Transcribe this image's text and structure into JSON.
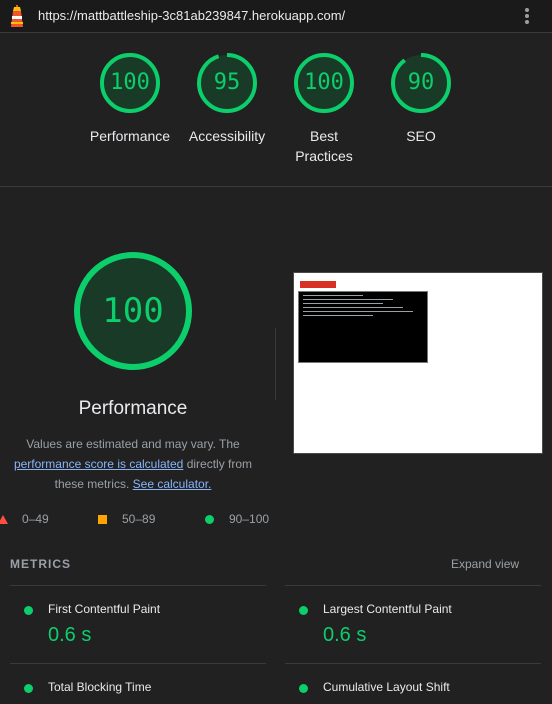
{
  "topbar": {
    "url": "https://mattbattleship-3c81ab239847.herokuapp.com/",
    "logo_icon": "lighthouse-icon",
    "menu_icon": "more-vertical-icon"
  },
  "summary": [
    {
      "score": "100",
      "label_line1": "Performance",
      "label_line2": ""
    },
    {
      "score": "95",
      "label_line1": "Accessibility",
      "label_line2": ""
    },
    {
      "score": "100",
      "label_line1": "Best",
      "label_line2": "Practices"
    },
    {
      "score": "90",
      "label_line1": "SEO",
      "label_line2": ""
    }
  ],
  "gauge_fill": [
    1.0,
    0.95,
    1.0,
    0.9
  ],
  "performance": {
    "score": "100",
    "title": "Performance",
    "desc_part1": "Values are estimated and may vary. The",
    "desc_link1": "performance score is calculated",
    "desc_part2": "directly from",
    "desc_part3": "these metrics.",
    "desc_link2": "See calculator."
  },
  "legend": [
    {
      "icon": "red-triangle-icon",
      "range": "0–49"
    },
    {
      "icon": "orange-square-icon",
      "range": "50–89"
    },
    {
      "icon": "green-circle-icon",
      "range": "90–100"
    }
  ],
  "metrics": {
    "heading": "METRICS",
    "expand_label": "Expand view",
    "items": [
      {
        "title": "First Contentful Paint",
        "value": "0.6 s"
      },
      {
        "title": "Largest Contentful Paint",
        "value": "0.6 s"
      },
      {
        "title": "Total Blocking Time",
        "value": ""
      },
      {
        "title": "Cumulative Layout Shift",
        "value": ""
      }
    ]
  },
  "colors": {
    "pass": "#0cce6b",
    "average": "#ffa400",
    "fail": "#ff4e42",
    "link": "#8ab4f8",
    "background": "#212121"
  }
}
